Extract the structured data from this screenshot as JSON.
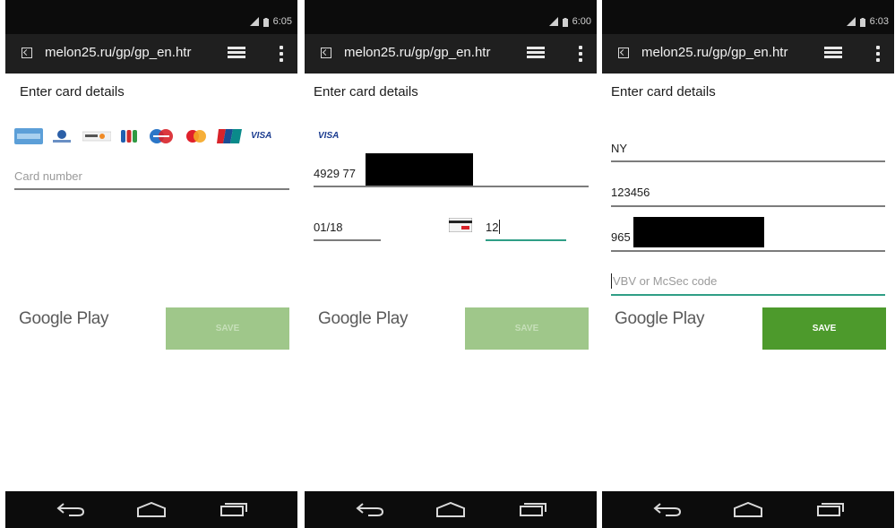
{
  "panels": [
    {
      "status_time": "6:05",
      "url": "melon25.ru/gp/gp_en.htr",
      "heading": "Enter card details",
      "card_number_placeholder": "Card number",
      "card_brands": [
        "american-express",
        "diners-club",
        "discover",
        "jcb",
        "maestro",
        "mastercard",
        "unionpay",
        "visa"
      ],
      "visa_label": "VISA",
      "google_play": "Google Play",
      "button_label": "SAVE",
      "button_state": "disabled"
    },
    {
      "status_time": "6:00",
      "url": "melon25.ru/gp/gp_en.htr",
      "heading": "Enter card details",
      "visa_label": "VISA",
      "card_number": "4929 77",
      "expiry": "01/18",
      "cvc": "12",
      "google_play": "Google Play",
      "button_label": "SAVE",
      "button_state": "disabled"
    },
    {
      "status_time": "6:03",
      "url": "melon25.ru/gp/gp_en.htr",
      "heading": "Enter card details",
      "city": "NY",
      "zip": "123456",
      "phone": "965",
      "vbv_placeholder": "VBV or McSec code",
      "google_play": "Google Play",
      "button_label": "SAVE",
      "button_state": "enabled"
    }
  ],
  "colors": {
    "status_bar": "#0c0c0c",
    "url_bar": "#1f1f1f",
    "button_enabled": "#4d9a2c",
    "button_disabled": "#9fc78a",
    "active_underline": "#2f9e86"
  }
}
